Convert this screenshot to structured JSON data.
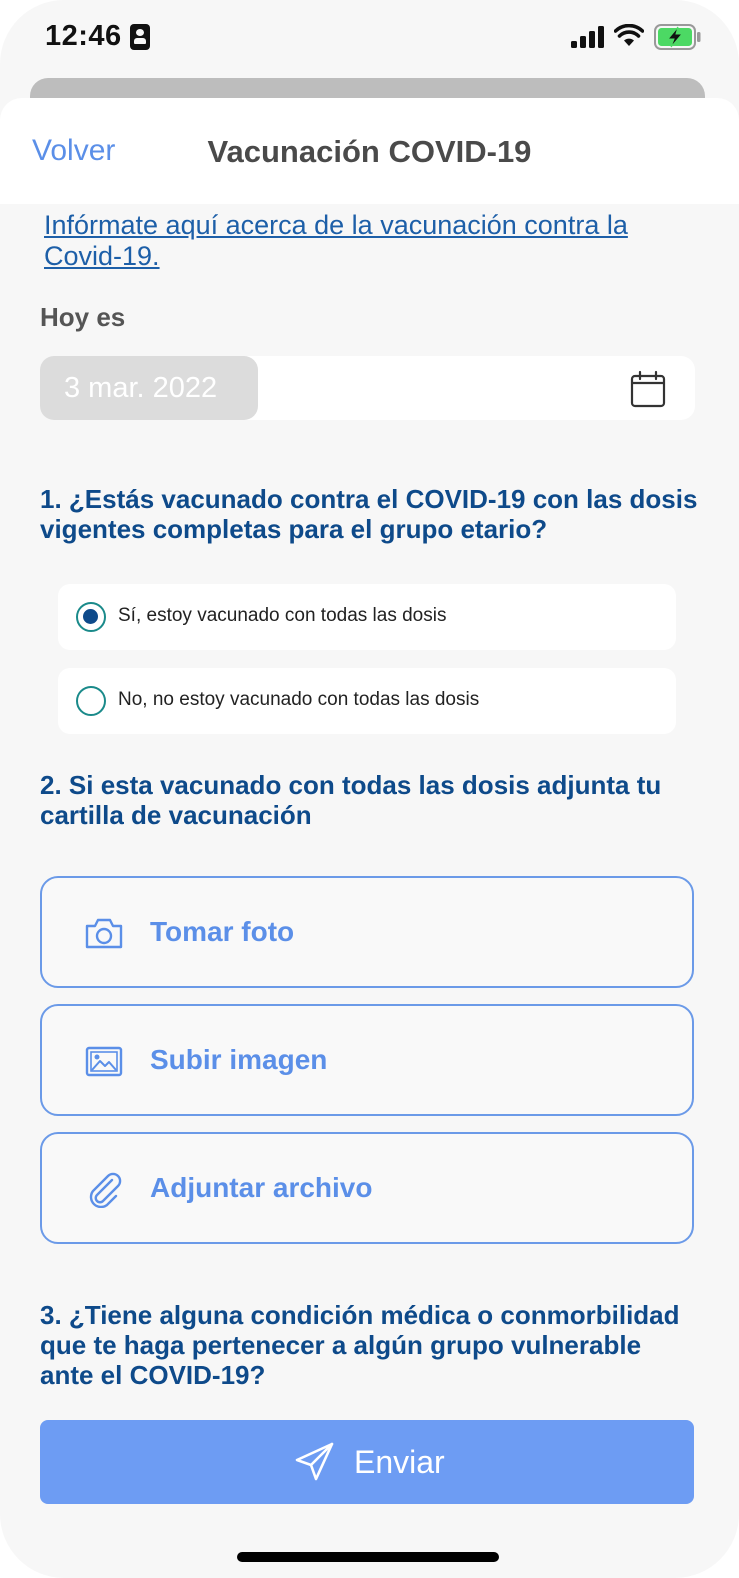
{
  "status_bar": {
    "time": "12:46"
  },
  "header": {
    "back_label": "Volver",
    "title": "Vacunación COVID-19"
  },
  "info_link": "Infórmate aquí acerca de la vacunación contra la Covid-19.",
  "today": {
    "label": "Hoy es",
    "date_value": "3 mar. 2022"
  },
  "questions": [
    {
      "text": "1. ¿Estás vacunado contra el COVID-19 con las dosis vigentes completas para el grupo etario?",
      "options": [
        {
          "label": "Sí, estoy vacunado con todas las dosis",
          "selected": true
        },
        {
          "label": "No, no estoy vacunado con todas las dosis",
          "selected": false
        }
      ]
    },
    {
      "text": "2. Si esta vacunado con todas las dosis adjunta tu cartilla de vacunación",
      "actions": [
        {
          "label": "Tomar foto",
          "icon": "camera-icon"
        },
        {
          "label": "Subir imagen",
          "icon": "image-icon"
        },
        {
          "label": "Adjuntar archivo",
          "icon": "paperclip-icon"
        }
      ]
    },
    {
      "text": "3. ¿Tiene alguna condición médica o conmorbilidad que te haga pertenecer a algún grupo vulnerable ante el COVID-19?"
    }
  ],
  "submit": {
    "label": "Enviar",
    "icon": "send-icon"
  },
  "colors": {
    "accent": "#5b8fe8",
    "question_text": "#0e4a8a",
    "link": "#1d5fa8",
    "submit_bg": "#6d9cf3",
    "radio_border": "#1a8a8a"
  }
}
